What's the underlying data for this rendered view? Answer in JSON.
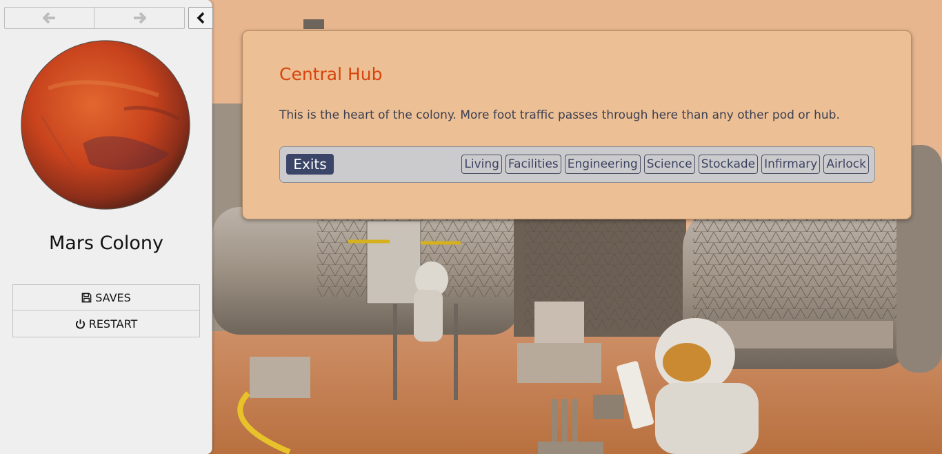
{
  "sidebar": {
    "back_icon": "arrow-left-icon",
    "forward_icon": "arrow-right-icon",
    "toggle_icon": "chevron-left-icon",
    "story_title": "Mars Colony",
    "saves_label": "SAVES",
    "saves_icon": "floppy-disk-icon",
    "restart_label": "RESTART",
    "restart_icon": "power-icon"
  },
  "passage": {
    "title": "Central Hub",
    "text": "This is the heart of the colony. More foot traffic passes through here than any other pod or hub.",
    "exits_label": "Exits",
    "exits": [
      {
        "label": "Living"
      },
      {
        "label": "Facilities"
      },
      {
        "label": "Engineering"
      },
      {
        "label": "Science"
      },
      {
        "label": "Stockade"
      },
      {
        "label": "Infirmary"
      },
      {
        "label": "Airlock"
      }
    ]
  },
  "colors": {
    "title_accent": "#d8440c",
    "exits_badge": "#3a4568",
    "panel_bg": "#ecbf94",
    "sky": "#e7b58e",
    "ground": "#c9834e"
  }
}
